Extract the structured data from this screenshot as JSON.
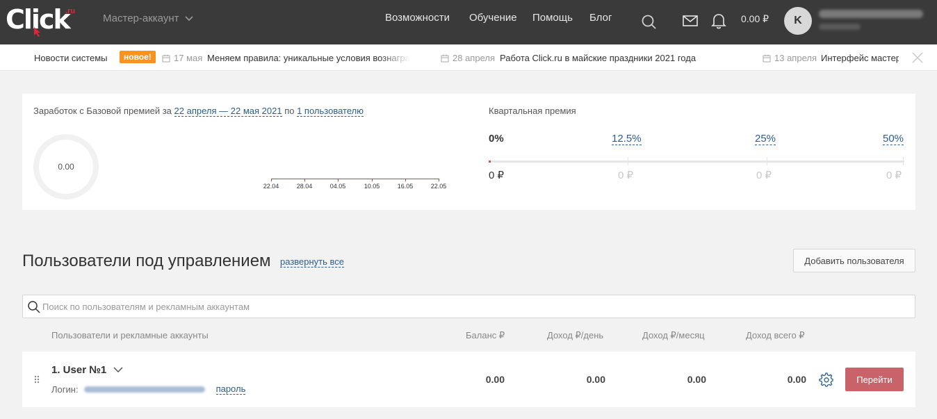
{
  "header": {
    "logo_text": "Click",
    "logo_suffix": ".ru",
    "account_switcher": "Мастер-аккаунт",
    "nav": [
      "Возможности",
      "Обучение",
      "Помощь",
      "Блог"
    ],
    "balance": "0.00 ₽",
    "avatar_letter": "K",
    "icons": [
      "search-icon",
      "mail-icon",
      "bell-icon",
      "chevron-down-icon"
    ]
  },
  "news": {
    "label": "Новости системы",
    "badge": "новое!",
    "items": [
      {
        "date": "17 мая",
        "title": "Меняем правила: уникальные условия вознагра"
      },
      {
        "date": "28 апреля",
        "title": "Работа Click.ru в майские праздники 2021 года"
      },
      {
        "date": "13 апреля",
        "title": "Интерфейс мастер"
      }
    ]
  },
  "earnings": {
    "title_prefix": "Заработок с Базовой премией за",
    "period": "22 апреля — 22 мая 2021",
    "title_mid": "по",
    "users_link": "1 пользователю",
    "total": "0.00",
    "axis_labels": [
      "22.04",
      "28.04",
      "04.05",
      "10.05",
      "16.05",
      "22.05"
    ]
  },
  "quarterly": {
    "title": "Квартальная премия",
    "levels": [
      "0%",
      "12.5%",
      "25%",
      "50%"
    ],
    "amounts": [
      "0 ₽",
      "0 ₽",
      "0 ₽",
      "0 ₽"
    ],
    "progress": 0
  },
  "users": {
    "title": "Пользователи под управлением",
    "expand_all": "развернуть все",
    "add_button": "Добавить пользователя",
    "search_placeholder": "Поиск по пользователям и рекламным аккаунтам",
    "columns": [
      "Пользователи и рекламные аккаунты",
      "Баланс ₽",
      "Доход ₽/день",
      "Доход ₽/месяц",
      "Доход всего ₽"
    ],
    "rows": [
      {
        "name": "1. User №1",
        "login_label": "Логин:",
        "password_link": "пароль",
        "balance": "0.00",
        "income_day": "0.00",
        "income_month": "0.00",
        "income_total": "0.00",
        "action": "Перейти"
      }
    ]
  },
  "colors": {
    "topbar": "#3a3a3a",
    "badge": "#f7931e",
    "accent": "#c9636a",
    "link": "#2a5d8f"
  }
}
